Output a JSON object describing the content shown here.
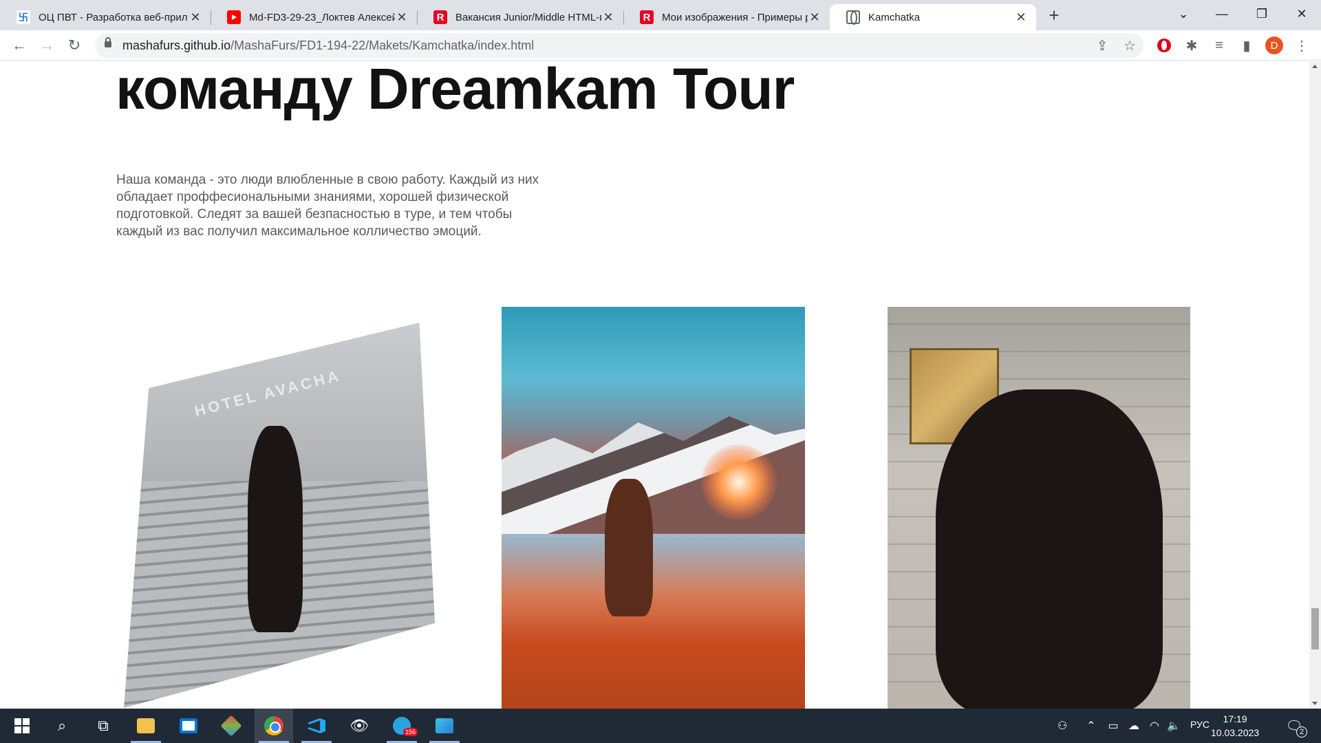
{
  "browser": {
    "tabs": [
      {
        "title": "ОЦ ПВТ - Разработка веб-прил",
        "favicon": "pvt-icon"
      },
      {
        "title": "Md-FD3-29-23_Локтев Алексей",
        "favicon": "youtube-icon"
      },
      {
        "title": "Вакансия Junior/Middle HTML-в",
        "favicon": "rabota-icon"
      },
      {
        "title": "Мои изображения - Примеры р",
        "favicon": "rabota-icon"
      },
      {
        "title": "Kamchatka",
        "favicon": "globe-icon",
        "active": true
      }
    ],
    "url": {
      "host": "mashafurs.github.io",
      "path": "/MashaFurs/FD1-194-22/Makets/Kamchatka/index.html"
    },
    "profile_initial": "D"
  },
  "page": {
    "heading": "команду Dreamkam Tour",
    "description_lines": [
      "Наша команда - это люди влюбленные в свою работу. Каждый из них",
      "обладает проффесиональными знаниями, хорошей физической",
      "подготовкой. Следят за вашей безпасностью в туре, и тем чтобы",
      "каждый из вас получил максимальное колличество эмоций."
    ],
    "photo1_sign": "HOTEL AVACHA"
  },
  "taskbar": {
    "telegram_badge": "156",
    "lang": "РУС",
    "time": "17:19",
    "date": "10.03.2023",
    "notification_count": "2"
  },
  "colors": {
    "heading": "#121212",
    "body_text": "#5a5a5a",
    "taskbar": "#202a36",
    "tabstrip": "#dee1e6"
  }
}
